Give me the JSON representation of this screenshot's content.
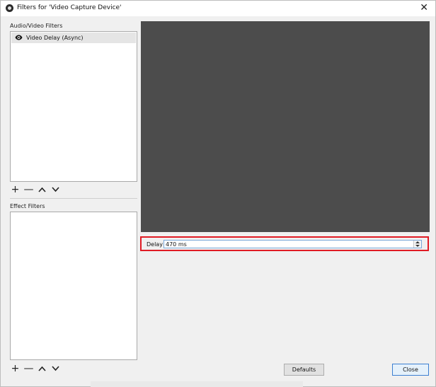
{
  "window": {
    "title": "Filters for 'Video Capture Device'"
  },
  "audio_video_filters": {
    "label": "Audio/Video Filters",
    "items": [
      {
        "label": "Video Delay (Async)",
        "icon": "eye-icon"
      }
    ]
  },
  "effect_filters": {
    "label": "Effect Filters",
    "items": []
  },
  "toolbar": {
    "add": "+",
    "remove": "—"
  },
  "properties": {
    "delay_label": "Delay",
    "delay_value": "470 ms"
  },
  "buttons": {
    "defaults": "Defaults",
    "close": "Close"
  },
  "colors": {
    "preview_bg": "#4c4c4c",
    "highlight_border": "#e01b24",
    "selected_item": "#e5e5e5"
  }
}
